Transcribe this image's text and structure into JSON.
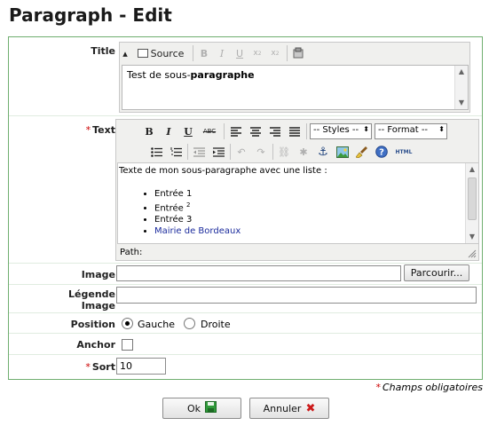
{
  "page": {
    "title": "Paragraph - Edit"
  },
  "fields": {
    "title": {
      "label": "Title",
      "toolbar": {
        "source_label": "Source"
      },
      "value_prefix": "Test de sous-",
      "value_bold": "paragraphe"
    },
    "text": {
      "required_marker": "*",
      "label": "Text",
      "toolbar": {
        "bold": "B",
        "italic": "I",
        "underline": "U",
        "strike": "ABC",
        "styles_label": "-- Styles --",
        "format_label": "-- Format --",
        "html_label": "HTML"
      },
      "intro": "Texte de mon sous-paragraphe avec une liste :",
      "list": [
        {
          "text": "Entrée 1"
        },
        {
          "text": "Entrée",
          "sup": "2"
        },
        {
          "text": "Entrée 3"
        }
      ],
      "link_text": "Mairie de Bordeaux",
      "path_label": "Path:"
    },
    "image": {
      "label": "Image",
      "browse_label": "Parcourir..."
    },
    "legende": {
      "label_line1": "Légende",
      "label_line2": "Image"
    },
    "position": {
      "label": "Position",
      "option1": "Gauche",
      "option2": "Droite",
      "selected": "Gauche"
    },
    "anchor": {
      "label": "Anchor",
      "checked": false
    },
    "sort": {
      "required_marker": "*",
      "label": "Sort",
      "value": "10"
    }
  },
  "footer": {
    "required_marker": "*",
    "required_note": "Champs obligatoires",
    "ok_label": "Ok",
    "cancel_label": "Annuler"
  },
  "colors": {
    "border": "#6fae6f",
    "link": "#1a2a9c",
    "required": "#cc0000"
  }
}
